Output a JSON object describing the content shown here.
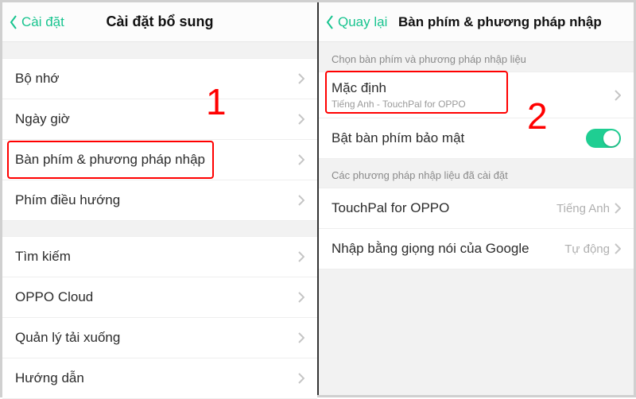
{
  "left": {
    "back_label": "Cài đặt",
    "title": "Cài đặt bổ sung",
    "group1": [
      "Bộ nhớ",
      "Ngày giờ",
      "Bàn phím & phương pháp nhập",
      "Phím điều hướng"
    ],
    "group2": [
      "Tìm kiếm",
      "OPPO Cloud",
      "Quản lý tải xuống",
      "Hướng dẫn"
    ],
    "annotation": "1"
  },
  "right": {
    "back_label": "Quay lại",
    "title": "Bàn phím & phương pháp nhập",
    "section1_header": "Chọn bàn phím và phương pháp nhập liệu",
    "default_row": {
      "label": "Mặc định",
      "sub": "Tiếng Anh - TouchPal for OPPO"
    },
    "security_row": {
      "label": "Bật bàn phím bảo mật"
    },
    "section2_header": "Các phương pháp nhập liệu đã cài đặt",
    "ime_rows": [
      {
        "label": "TouchPal for OPPO",
        "trail": "Tiếng Anh"
      },
      {
        "label": "Nhập bằng giọng nói của Google",
        "trail": "Tự động"
      }
    ],
    "annotation": "2"
  }
}
